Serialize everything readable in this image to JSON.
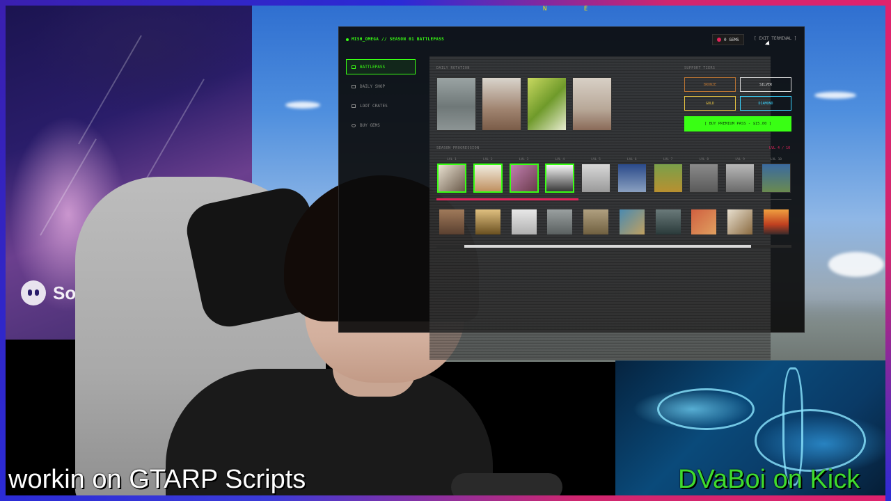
{
  "stream": {
    "caption_left": "workin on GTARP Scripts",
    "caption_right": "DVaBoi on Kick",
    "sora_label": "Sora"
  },
  "game_hud": {
    "compass_letters": "N E"
  },
  "battlepass": {
    "title": "MISH_OMEGA // SEASON 01 BATTLEPASS",
    "gems": "0 GEMS",
    "exit": "[ EXIT TERMINAL ]",
    "nav": [
      {
        "label": "BATTLEPASS",
        "icon": "ticket-icon",
        "active": true
      },
      {
        "label": "DAILY SHOP",
        "icon": "shop-icon",
        "active": false
      },
      {
        "label": "LOOT CRATES",
        "icon": "crate-icon",
        "active": false
      },
      {
        "label": "BUY GEMS",
        "icon": "gem-icon",
        "active": false
      }
    ],
    "daily_rotation_label": "DAILY ROTATION",
    "support_tiers_label": "SUPPORT TIERS",
    "tiers": [
      {
        "label": "BRONZE",
        "color": "#b87333"
      },
      {
        "label": "SILVER",
        "color": "#d8d8d8"
      },
      {
        "label": "GOLD",
        "color": "#e6c341"
      },
      {
        "label": "DIAMOND",
        "color": "#39d5ff"
      }
    ],
    "buy_premium": "[ BUY PREMIUM PASS - $15.00 ]",
    "season_progression_label": "SEASON PROGRESSION",
    "progression_count": "LVL 4 / 10",
    "progress_fraction": 0.4,
    "levels": [
      {
        "label": "LVL 1",
        "claimed": true
      },
      {
        "label": "LVL 2",
        "claimed": true
      },
      {
        "label": "LVL 3",
        "claimed": true
      },
      {
        "label": "LVL 4",
        "claimed": true
      },
      {
        "label": "LVL 5",
        "claimed": false
      },
      {
        "label": "LVL 6",
        "claimed": false
      },
      {
        "label": "LVL 7",
        "claimed": false
      },
      {
        "label": "LVL 8",
        "claimed": false
      },
      {
        "label": "LVL 9",
        "claimed": false
      },
      {
        "label": "LVL 10",
        "claimed": false
      }
    ],
    "accent_color": "#39ff14",
    "progress_color": "#e0245a"
  }
}
